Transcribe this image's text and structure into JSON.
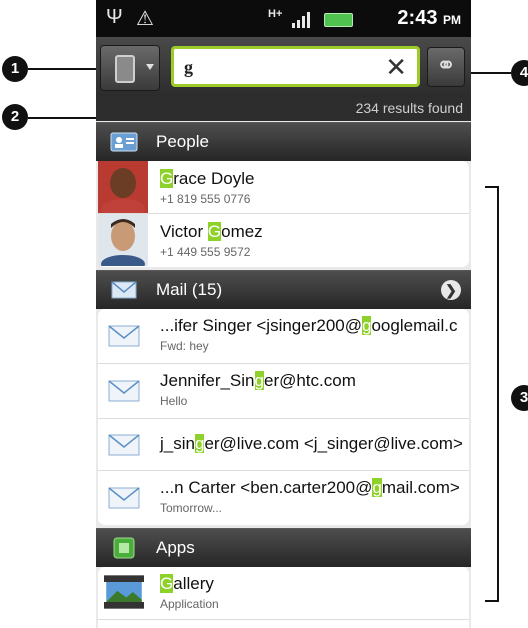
{
  "status_bar": {
    "time": "2:43",
    "ampm": "PM",
    "network": "H+"
  },
  "search": {
    "query": "g",
    "results_text": "234 results found"
  },
  "sections": {
    "people": {
      "title": "People"
    },
    "mail": {
      "title": "Mail (15)"
    },
    "apps": {
      "title": "Apps"
    }
  },
  "people": [
    {
      "pre": "",
      "hl": "G",
      "post": "race Doyle",
      "sub": "+1 819 555 0776"
    },
    {
      "pre": "Victor ",
      "hl": "G",
      "post": "omez",
      "sub": "+1 449 555 9572"
    }
  ],
  "mail": [
    {
      "pre": "...ifer Singer <jsinger200@",
      "hl": "g",
      "post": "ooglemail.c",
      "sub": "Fwd: hey"
    },
    {
      "pre": "Jennifer_Sin",
      "hl": "g",
      "post": "er@htc.com",
      "sub": "Hello"
    },
    {
      "pre": "j_sin",
      "hl": "g",
      "post": "er@live.com <j_singer@live.com>",
      "sub": ""
    },
    {
      "pre": "...n Carter <ben.carter200@",
      "hl": "g",
      "post": "mail.com>",
      "sub": "Tomorrow..."
    }
  ],
  "apps": [
    {
      "pre": "",
      "hl": "G",
      "post": "allery",
      "sub": "Application"
    }
  ],
  "callouts": [
    "1",
    "2",
    "3",
    "4"
  ]
}
